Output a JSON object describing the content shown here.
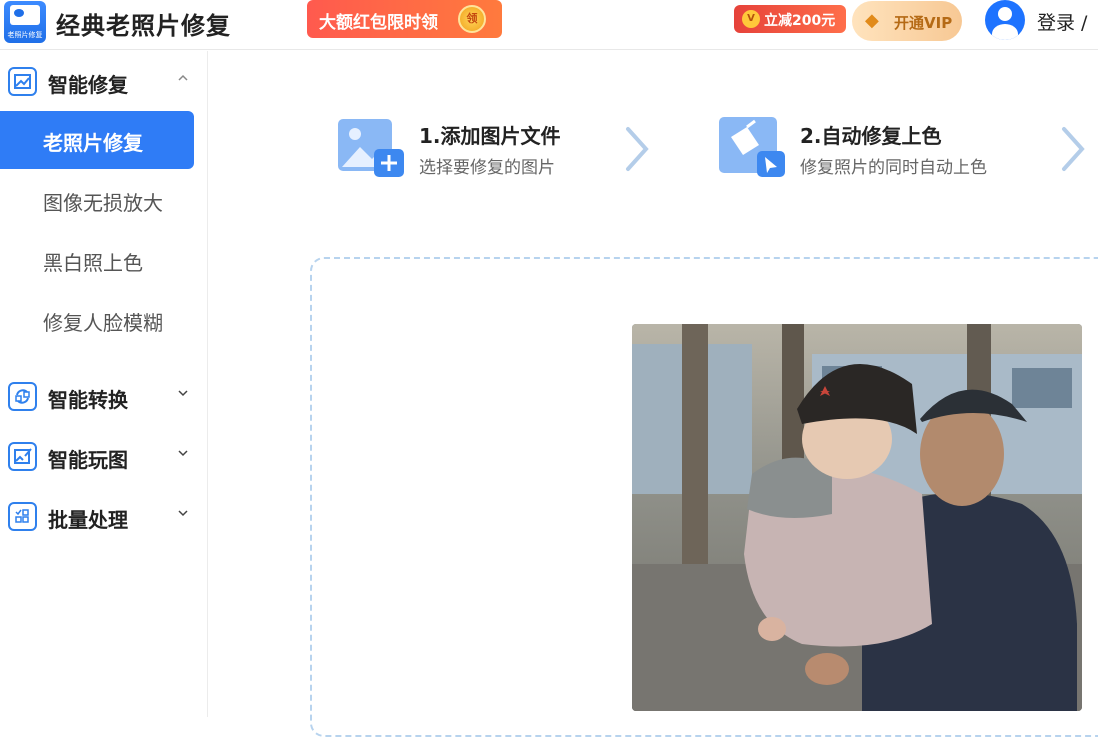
{
  "header": {
    "logo_icon": "photo-repair-logo-icon",
    "logo_tag": "老照片修复",
    "app_title": "经典老照片修复",
    "promo_label": "大额红包限时领",
    "promo_coin": "领",
    "discount_coin": "V",
    "discount_label": "立减200元",
    "vip_label": "开通VIP",
    "login_label": "登录 /"
  },
  "sidebar": {
    "groups": [
      {
        "label": "智能修复",
        "icon": "image-icon",
        "chevron": "chevron-up-icon"
      },
      {
        "label": "智能转换",
        "icon": "convert-icon",
        "chevron": "chevron-down-icon"
      },
      {
        "label": "智能玩图",
        "icon": "edit-image-icon",
        "chevron": "chevron-down-icon"
      },
      {
        "label": "批量处理",
        "icon": "batch-icon",
        "chevron": "chevron-down-icon"
      }
    ],
    "items": [
      {
        "label": "老照片修复",
        "active": true
      },
      {
        "label": "图像无损放大",
        "active": false
      },
      {
        "label": "黑白照上色",
        "active": false
      },
      {
        "label": "修复人脸模糊",
        "active": false
      }
    ]
  },
  "steps": [
    {
      "title": "1.添加图片文件",
      "subtitle": "选择要修复的图片",
      "icon": "add-image-icon"
    },
    {
      "title": "2.自动修复上色",
      "subtitle": "修复照片的同时自动上色",
      "icon": "paint-bucket-icon"
    }
  ],
  "colors": {
    "accent": "#2f7cf6",
    "promo": "#ff5a4e",
    "vip": "#f7c894",
    "dashed_border": "#b7d3ee"
  }
}
